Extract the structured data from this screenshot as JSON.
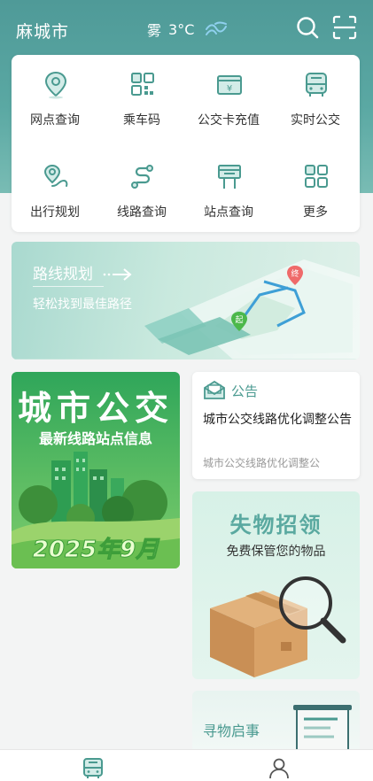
{
  "topbar": {
    "city": "麻城市",
    "weather_text": "雾",
    "temperature": "3°C",
    "icons": [
      "fog-icon",
      "search-icon",
      "scan-icon"
    ]
  },
  "quick_grid": {
    "items": [
      {
        "label": "网点查询",
        "icon": "location-pin-icon"
      },
      {
        "label": "乘车码",
        "icon": "qr-code-icon"
      },
      {
        "label": "公交卡充值",
        "icon": "card-recharge-icon"
      },
      {
        "label": "实时公交",
        "icon": "bus-icon"
      },
      {
        "label": "出行规划",
        "icon": "route-plan-icon"
      },
      {
        "label": "线路查询",
        "icon": "route-search-icon"
      },
      {
        "label": "站点查询",
        "icon": "bus-stop-icon"
      },
      {
        "label": "更多",
        "icon": "more-grid-icon"
      }
    ]
  },
  "route_banner": {
    "title": "路线规划",
    "subtitle": "轻松找到最佳路径",
    "map_start_label": "起",
    "map_end_label": "终"
  },
  "bus_promo": {
    "title": "城市公交",
    "subtitle": "最新线路站点信息",
    "date": "2025年9月"
  },
  "notice": {
    "label": "公告",
    "title": "城市公交线路优化调整公告",
    "description": "城市公交线路优化调整公"
  },
  "lost_found": {
    "title": "失物招领",
    "subtitle": "免费保管您的物品"
  },
  "find_notice": {
    "title": "寻物启事"
  },
  "tabbar": {
    "icons": [
      "bus-tab-icon",
      "user-tab-icon"
    ],
    "accent": "#4a9a90"
  },
  "colors": {
    "primary": "#5aa8a3",
    "icon": "#4a9a90"
  }
}
